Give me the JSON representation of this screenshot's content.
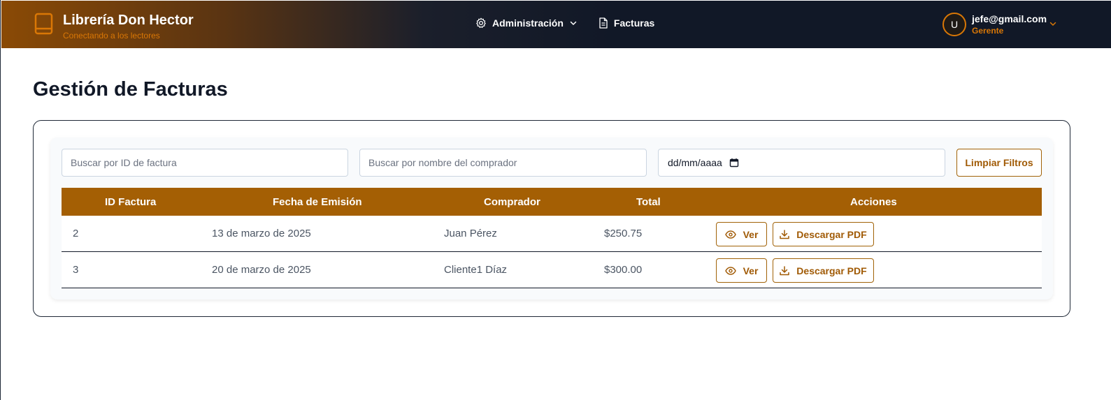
{
  "header": {
    "brand_title": "Librería Don Hector",
    "brand_subtitle": "Conectando a los lectores",
    "nav": [
      {
        "label": "Administración",
        "icon": "gear-icon"
      },
      {
        "label": "Facturas",
        "icon": "document-icon"
      }
    ],
    "user": {
      "avatar_initial": "U",
      "email": "jefe@gmail.com",
      "role": "Gerente"
    }
  },
  "page": {
    "title": "Gestión de Facturas"
  },
  "filters": {
    "id_placeholder": "Buscar por ID de factura",
    "buyer_placeholder": "Buscar por nombre del comprador",
    "date_placeholder": "dd/mm/aaaa",
    "clear_label": "Limpiar Filtros"
  },
  "table": {
    "headers": [
      "ID Factura",
      "Fecha de Emisión",
      "Comprador",
      "Total",
      "Acciones"
    ],
    "rows": [
      {
        "id": "2",
        "date": "13 de marzo de 2025",
        "buyer": "Juan Pérez",
        "total": "$250.75"
      },
      {
        "id": "3",
        "date": "20 de marzo de 2025",
        "buyer": "Cliente1 Díaz",
        "total": "$300.00"
      }
    ],
    "view_label": "Ver",
    "download_label": "Descargar PDF"
  },
  "colors": {
    "accent": "#a45f04",
    "accent_text": "#d97706",
    "header_dark": "#111827"
  }
}
